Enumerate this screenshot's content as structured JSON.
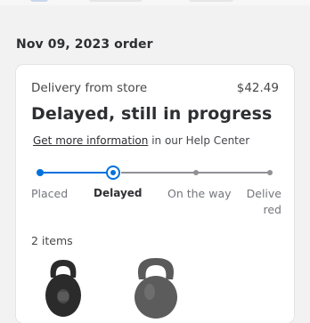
{
  "order": {
    "date_heading": "Nov 09, 2023 order"
  },
  "card": {
    "delivery_label": "Delivery from store",
    "price": "$42.49",
    "status_title": "Delayed, still in progress",
    "help_link": "Get more information",
    "help_suffix": "in our Help Center"
  },
  "tracker": {
    "steps": [
      "Placed",
      "Delayed",
      "On the way",
      "Delivered"
    ],
    "current_step": 1
  },
  "items": {
    "count_label": "2 items",
    "products": [
      {
        "icon": "kettlebell-icon",
        "color": "#2b2b2b"
      },
      {
        "icon": "kettlebell-icon",
        "color": "#5a5a5a"
      }
    ]
  },
  "colors": {
    "accent": "#0071dc",
    "inactive": "#909196"
  }
}
